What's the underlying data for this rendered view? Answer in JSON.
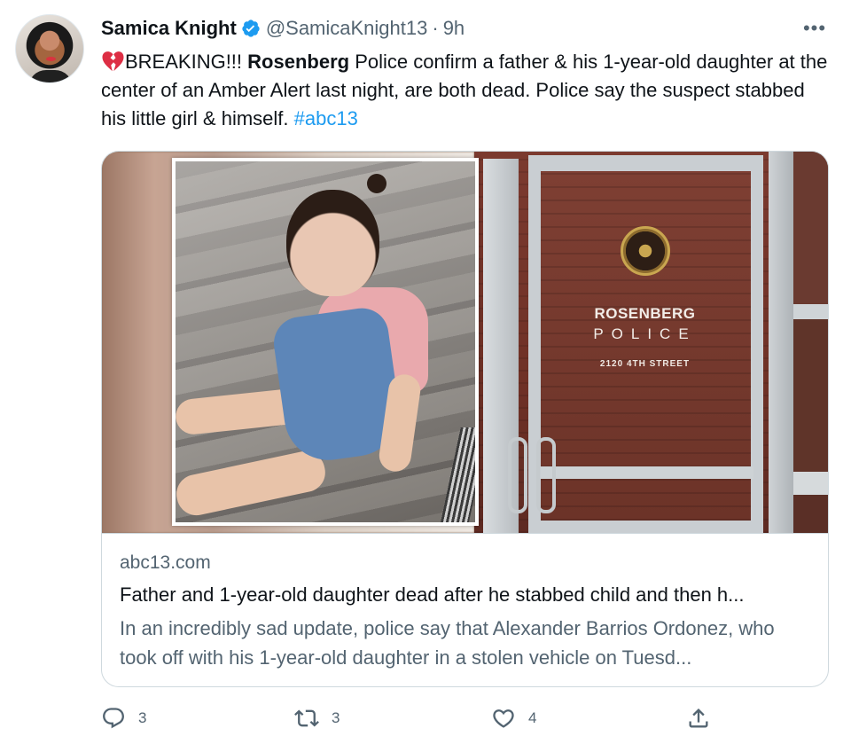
{
  "tweet": {
    "author_name": "Samica Knight",
    "handle": "@SamicaKnight13",
    "separator": "·",
    "time": "9h",
    "more_label": "•••",
    "text_parts": {
      "p1": "BREAKING!!! ",
      "bold": "Rosenberg",
      "p2": " Police confirm a father & his 1-year-old daughter at the center of an Amber Alert last night, are both dead. Police say the suspect stabbed his little girl & himself. ",
      "hashtag": "#abc13"
    }
  },
  "card": {
    "image_sign": {
      "line1": "ROSENBERG",
      "line2": "POLICE",
      "line3": "2120 4TH STREET"
    },
    "domain": "abc13.com",
    "title": "Father and 1-year-old daughter dead after he stabbed child and then h...",
    "description": "In an incredibly sad update, police say that Alexander Barrios Ordonez, who took off with his 1-year-old daughter in a stolen vehicle on Tuesd..."
  },
  "actions": {
    "reply_count": "3",
    "retweet_count": "3",
    "like_count": "4"
  },
  "colors": {
    "accent": "#1d9bf0",
    "secondary_text": "#536471",
    "primary_text": "#0f1419",
    "broken_heart": "#dd2e44"
  },
  "icons": [
    "verified-badge-icon",
    "broken-heart-icon",
    "more-icon",
    "reply-icon",
    "retweet-icon",
    "like-icon",
    "share-icon"
  ]
}
